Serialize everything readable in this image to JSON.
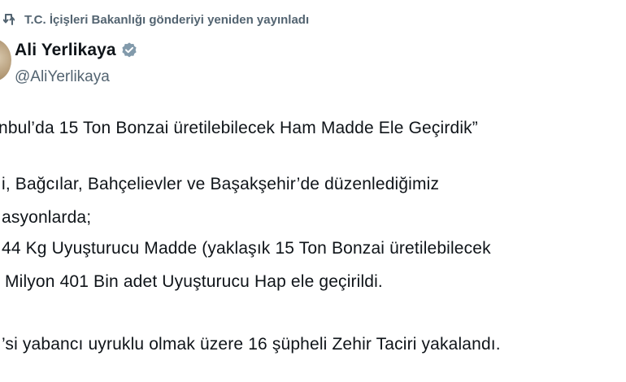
{
  "repost": {
    "text": "T.C. İçişleri Bakanlığı gönderiyi yeniden yayınladı",
    "icon": "repost-icon"
  },
  "author": {
    "name": "Ali Yerlikaya",
    "handle": "@AliYerlikaya",
    "verified_icon": "verified-badge-icon",
    "verified_color": "#829aab"
  },
  "tweet": {
    "lines": [
      "nbul’da 15 Ton Bonzai üretilebilecek Ham Madde Ele Geçirdik”",
      "i, Bağcılar, Bahçelievler ve Başakşehir’de düzenlediğimiz",
      "asyonlarda;",
      "44 Kg Uyuşturucu Madde (yaklaşık 15 Ton Bonzai üretilebilecek",
      "Milyon 401 Bin adet Uyuşturucu Hap ele geçirildi.",
      "’si yabancı uyruklu olmak üzere 16 şüpheli Zehir Taciri yakalandı."
    ]
  },
  "colors": {
    "text_primary": "#0f1419",
    "text_secondary": "#536471"
  }
}
